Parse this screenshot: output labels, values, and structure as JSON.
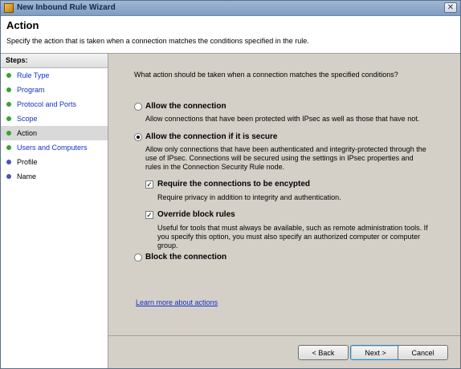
{
  "window": {
    "title": "New Inbound Rule Wizard",
    "close_glyph": "✕"
  },
  "header": {
    "title": "Action",
    "description": "Specify the action that is taken when a connection matches the conditions specified in the rule."
  },
  "steps": {
    "heading": "Steps:",
    "items": [
      {
        "label": "Rule Type",
        "state": "done"
      },
      {
        "label": "Program",
        "state": "done"
      },
      {
        "label": "Protocol and Ports",
        "state": "done"
      },
      {
        "label": "Scope",
        "state": "done"
      },
      {
        "label": "Action",
        "state": "current"
      },
      {
        "label": "Users and Computers",
        "state": "done"
      },
      {
        "label": "Profile",
        "state": "pending"
      },
      {
        "label": "Name",
        "state": "pending"
      }
    ]
  },
  "main": {
    "question": "What action should be taken when a connection matches the specified conditions?",
    "allow": {
      "label": "Allow the connection",
      "description": "Allow connections that have been protected with IPsec as well as those that have not."
    },
    "allow_secure": {
      "label": "Allow the connection if it is secure",
      "description": "Allow only connections that have been authenticated and integrity-protected through the use of IPsec.  Connections will be secured using the settings in IPsec properties and rules in the Connection Security Rule node."
    },
    "require_encryption": {
      "label": "Require the connections to be encypted",
      "description": "Require privacy in addition to integrity and authentication.",
      "checked": true
    },
    "override_block": {
      "label": "Override block rules",
      "description": "Useful for tools that must always be available, such as remote administration tools.  If you specify this option, you must also specify an authorized computer or computer group.",
      "checked": true
    },
    "block": {
      "label": "Block the connection"
    },
    "selected_option": "allow_secure",
    "learn_more": "Learn more about actions"
  },
  "buttons": {
    "back": "< Back",
    "next": "Next >",
    "cancel": "Cancel"
  },
  "check_glyph": "✓"
}
